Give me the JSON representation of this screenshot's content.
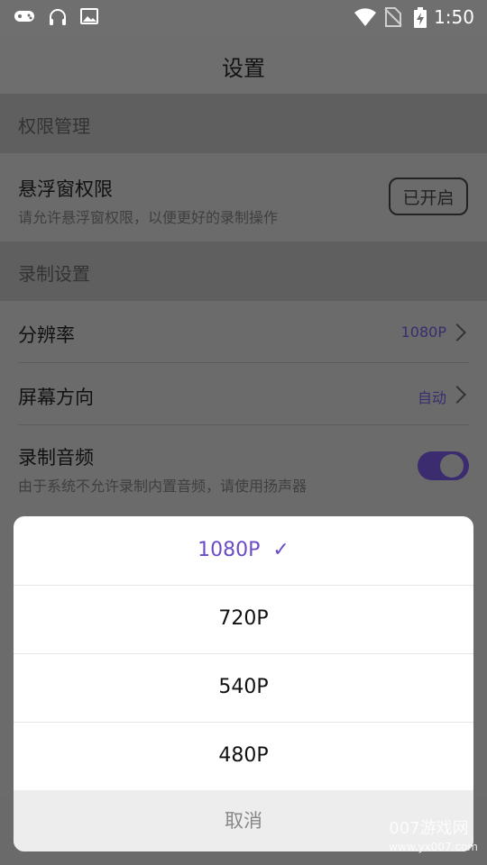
{
  "status_bar": {
    "time": "1:50",
    "icons_left": [
      "gamepad-icon",
      "headset-icon",
      "image-icon"
    ],
    "icons_right": [
      "wifi-icon",
      "no-sim-icon",
      "battery-charging-icon"
    ]
  },
  "header": {
    "title": "设置"
  },
  "sections": {
    "permissions": "权限管理",
    "recording": "录制设置"
  },
  "overlay_permission": {
    "title": "悬浮窗权限",
    "subtitle": "请允许悬浮窗权限，以便更好的录制操作",
    "button": "已开启"
  },
  "resolution": {
    "title": "分辨率",
    "value": "1080P"
  },
  "orientation": {
    "title": "屏幕方向",
    "value": "自动"
  },
  "audio": {
    "title": "录制音频",
    "subtitle": "由于系统不允许录制内置音频，请使用扬声器",
    "enabled": true
  },
  "sheet": {
    "options": [
      {
        "label": "1080P",
        "selected": true
      },
      {
        "label": "720P",
        "selected": false
      },
      {
        "label": "540P",
        "selected": false
      },
      {
        "label": "480P",
        "selected": false
      }
    ],
    "check_mark": "✓",
    "cancel": "取消"
  },
  "watermark": {
    "line1": "007游戏网",
    "line2": "www.yx007.com"
  },
  "colors": {
    "accent": "#6a4cc7",
    "toggle_on": "#3a2c6e",
    "overlay": "#6b6b6b"
  }
}
